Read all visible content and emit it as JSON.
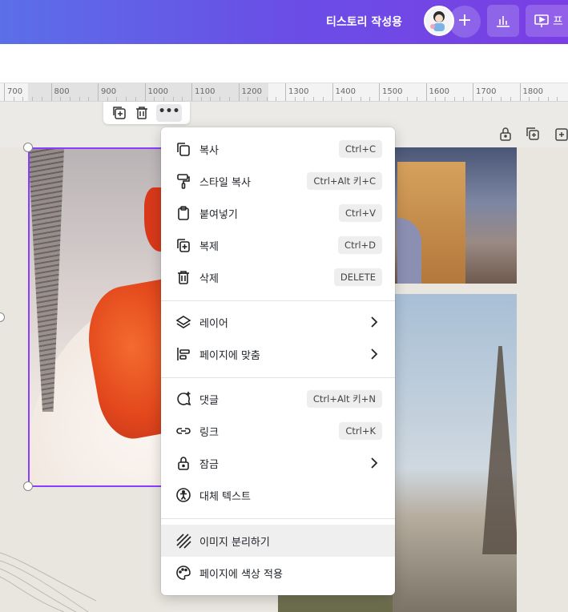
{
  "header": {
    "title": "티스토리 작성용",
    "present_label": "프"
  },
  "ruler": {
    "ticks": [
      "700",
      "800",
      "900",
      "1000",
      "1100",
      "1200",
      "1300",
      "1400",
      "1500",
      "1600",
      "1700",
      "1800"
    ]
  },
  "element_toolbar": {
    "more_label": "•••"
  },
  "context_menu": {
    "items": [
      {
        "label": "복사",
        "shortcut": "Ctrl+C",
        "icon": "copy-icon"
      },
      {
        "label": "스타일 복사",
        "shortcut": "Ctrl+Alt 키+C",
        "icon": "paint-roller-icon"
      },
      {
        "label": "붙여넣기",
        "shortcut": "Ctrl+V",
        "icon": "clipboard-icon"
      },
      {
        "label": "복제",
        "shortcut": "Ctrl+D",
        "icon": "duplicate-icon"
      },
      {
        "label": "삭제",
        "shortcut": "DELETE",
        "icon": "trash-icon"
      },
      {
        "label": "레이어",
        "icon": "layers-icon"
      },
      {
        "label": "페이지에 맞춤",
        "icon": "align-icon"
      },
      {
        "label": "댓글",
        "shortcut": "Ctrl+Alt 키+N",
        "icon": "comment-add-icon"
      },
      {
        "label": "링크",
        "shortcut": "Ctrl+K",
        "icon": "link-icon"
      },
      {
        "label": "잠금",
        "icon": "lock-icon"
      },
      {
        "label": "대체 텍스트",
        "icon": "accessibility-icon"
      },
      {
        "label": "이미지 분리하기",
        "icon": "detach-image-icon"
      },
      {
        "label": "페이지에 색상 적용",
        "icon": "palette-icon"
      }
    ]
  },
  "colors": {
    "accent": "#8b3dff",
    "header_gradient_start": "#5b6fe8",
    "header_gradient_end": "#7a3ee4"
  }
}
